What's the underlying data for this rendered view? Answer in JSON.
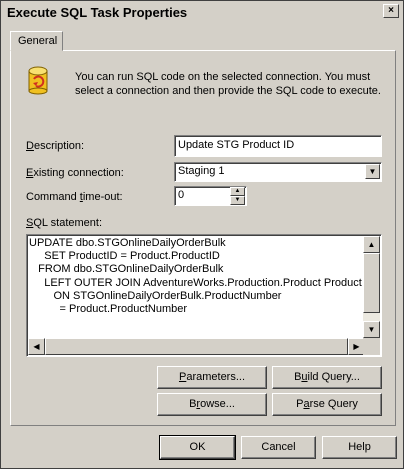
{
  "window": {
    "title": "Execute SQL Task Properties",
    "close_label": "×"
  },
  "tabs": [
    {
      "label": "General"
    }
  ],
  "info_text": "You can run SQL code on the selected connection.  You must select a connection and then provide the SQL code to execute.",
  "form": {
    "description": {
      "label_prefix": "",
      "label_key": "D",
      "label_rest": "escription:",
      "value": "Update STG Product ID"
    },
    "connection": {
      "label_key": "E",
      "label_rest": "xisting connection:",
      "value": "Staging 1"
    },
    "timeout": {
      "label_pre": "Command ",
      "label_key": "t",
      "label_rest": "ime-out:",
      "value": "0"
    },
    "sql": {
      "label_key": "S",
      "label_rest": "QL statement:",
      "text": "UPDATE dbo.STGOnlineDailyOrderBulk\n     SET ProductID = Product.ProductID\n   FROM dbo.STGOnlineDailyOrderBulk\n     LEFT OUTER JOIN AdventureWorks.Production.Product Product\n        ON STGOnlineDailyOrderBulk.ProductNumber\n          = Product.ProductNumber"
    }
  },
  "buttons": {
    "parameters": {
      "key": "P",
      "rest": "arameters..."
    },
    "build_query": {
      "pre": "B",
      "key": "u",
      "rest": "ild Query..."
    },
    "browse": {
      "pre": "B",
      "key": "r",
      "rest": "owse..."
    },
    "parse_query": {
      "pre": "P",
      "key": "a",
      "rest": "rse Query"
    },
    "ok": "OK",
    "cancel": "Cancel",
    "help": "Help"
  },
  "colors": {
    "dialog_bg": "#d4d0c8",
    "field_bg": "#ffffff",
    "icon_yellow": "#f0c020",
    "icon_red": "#d03020"
  }
}
